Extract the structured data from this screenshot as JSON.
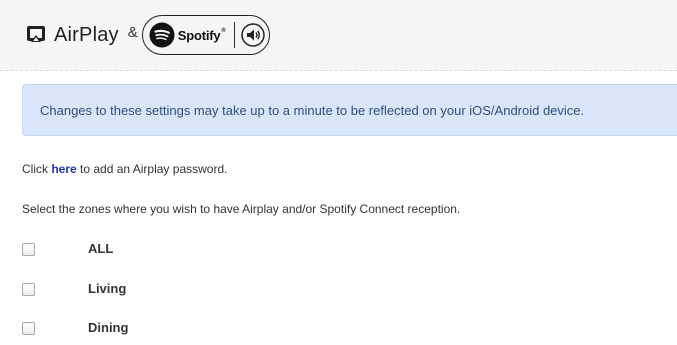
{
  "header": {
    "airplay_label": "AirPlay",
    "ampersand": "&",
    "spotify_label": "Spotify",
    "spotify_tm": "®",
    "icons": [
      "airplay-icon",
      "spotify-icon",
      "speaker-icon"
    ]
  },
  "notice": {
    "text": "Changes to these settings may take up to a minute to be reflected on your iOS/Android device.",
    "background_color": "#d9e5fb",
    "text_color": "#31507a"
  },
  "password_line": {
    "prefix": "Click ",
    "link_text": "here",
    "suffix": " to add an Airplay password.",
    "link_color": "#1a37b8"
  },
  "zones_instruction": "Select the zones where you wish to have Airplay and/or Spotify Connect reception.",
  "zones": [
    {
      "label": "ALL",
      "checked": false
    },
    {
      "label": "Living",
      "checked": false
    },
    {
      "label": "Dining",
      "checked": false
    }
  ]
}
